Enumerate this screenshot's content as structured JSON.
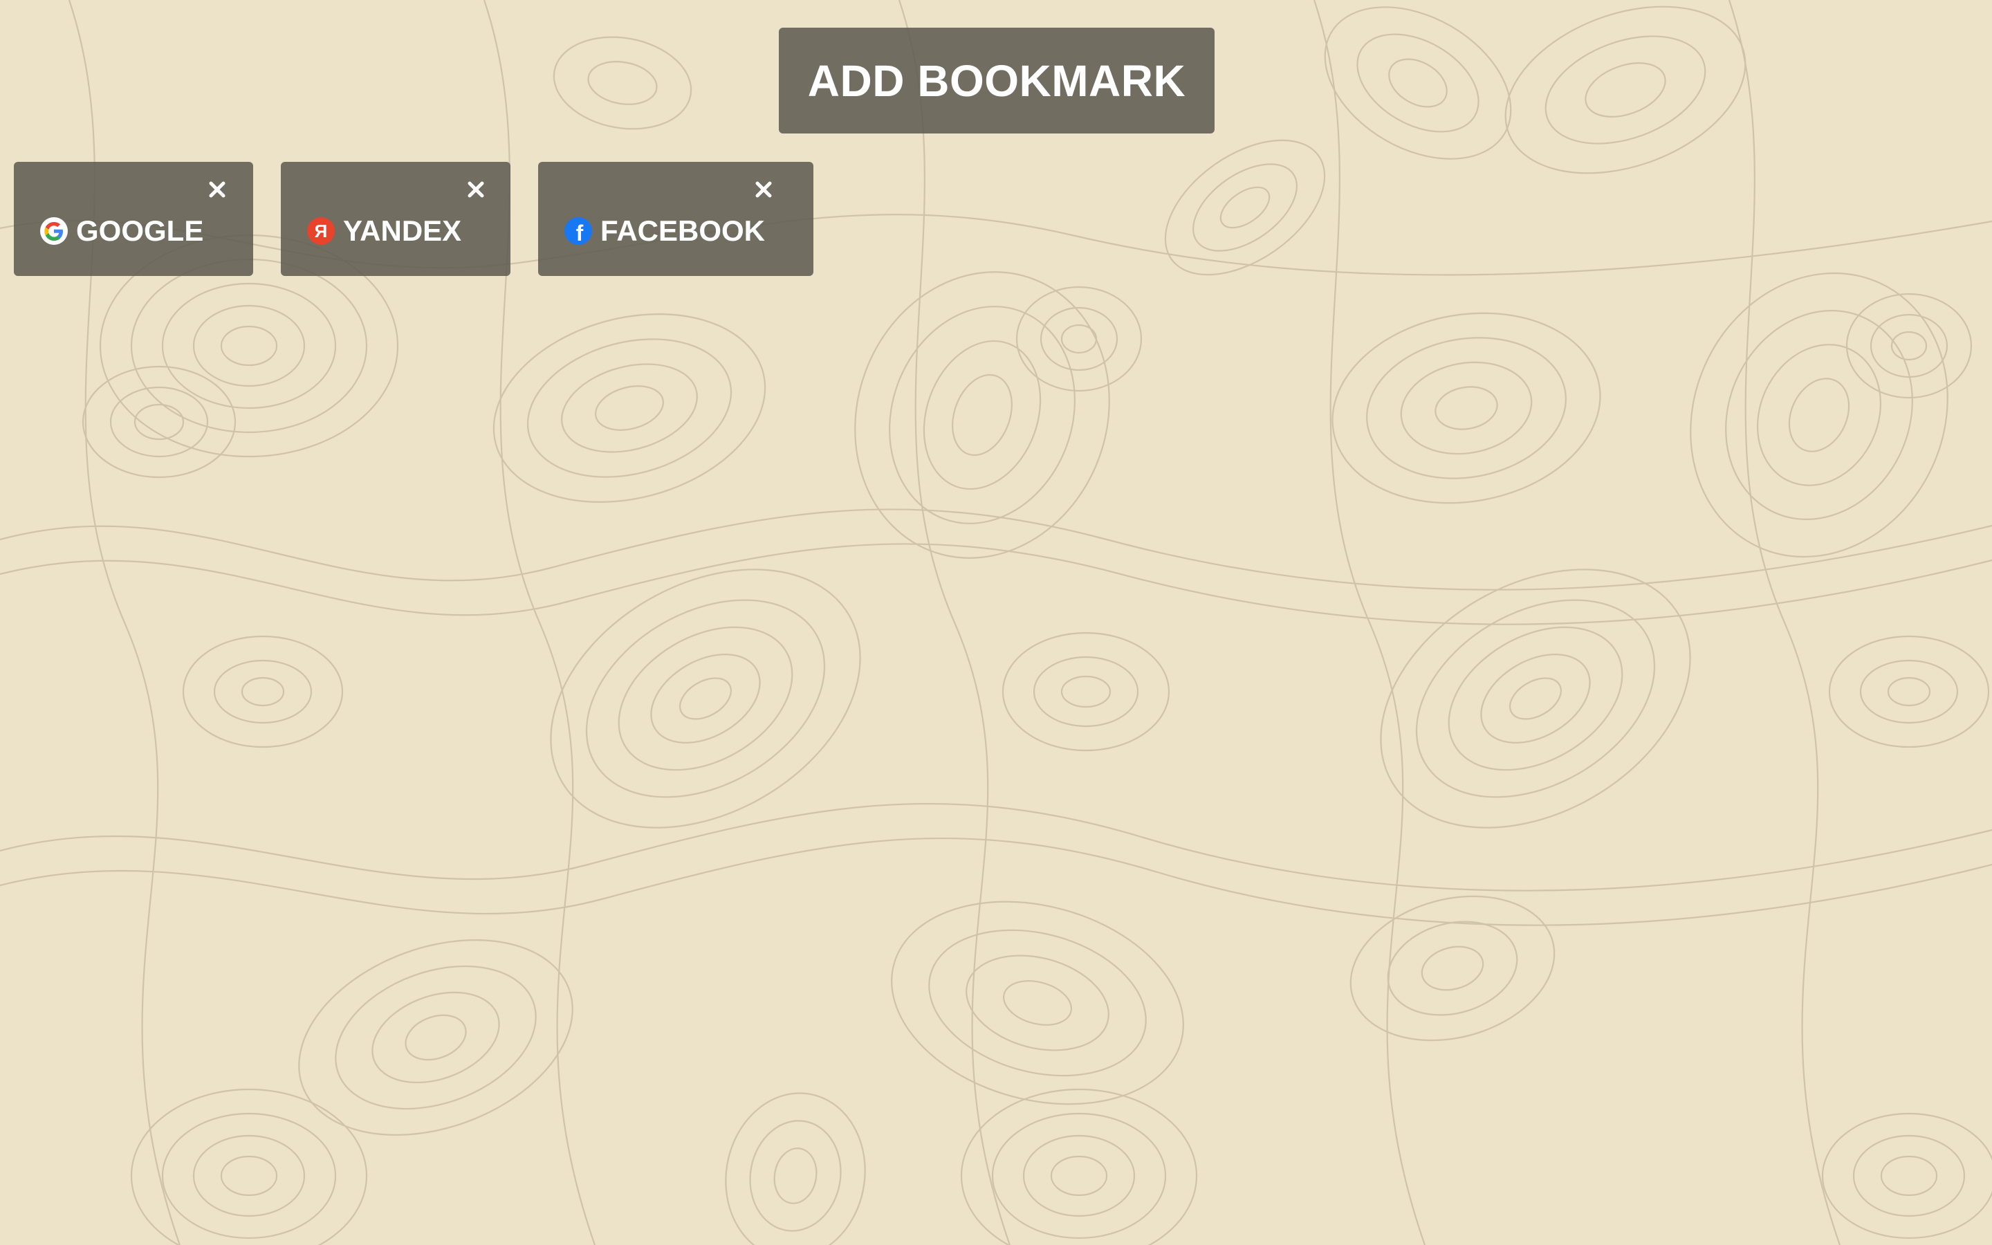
{
  "header": {
    "add_bookmark_label": "ADD BOOKMARK"
  },
  "bookmarks": [
    {
      "label": "GOOGLE",
      "icon": "google-icon",
      "close_icon": "close-icon"
    },
    {
      "label": "YANDEX",
      "icon": "yandex-icon",
      "icon_text": "Я",
      "close_icon": "close-icon"
    },
    {
      "label": "FACEBOOK",
      "icon": "facebook-icon",
      "icon_text": "f",
      "close_icon": "close-icon"
    }
  ],
  "colors": {
    "background": "#ede3c9",
    "contour_line": "#c9bea3",
    "tile": "#605c52",
    "text": "#ffffff",
    "google_blue": "#4285f4",
    "google_red": "#ea4335",
    "google_yellow": "#fbbc05",
    "google_green": "#34a853",
    "yandex_red": "#e8432b",
    "facebook_blue": "#1877f2"
  }
}
